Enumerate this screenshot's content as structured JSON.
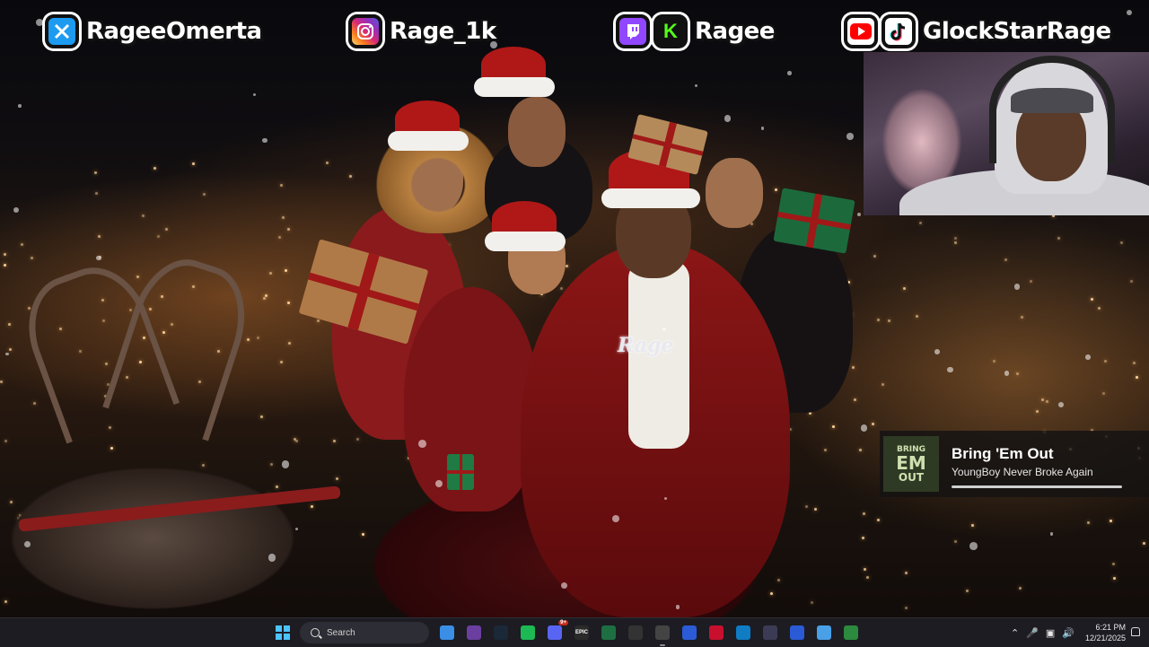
{
  "socials": [
    {
      "platform": "x-twitter",
      "icon": "x-twitter-icon",
      "handle": "RageeOmerta",
      "color": "#1d9bf0"
    },
    {
      "platform": "instagram",
      "icon": "instagram-icon",
      "handle": "Rage_1k",
      "color": "#e1306c"
    },
    {
      "platform": "twitch-kick",
      "icons": [
        "twitch-icon",
        "kick-icon"
      ],
      "handle": "Ragee",
      "colors": [
        "#9146ff",
        "#53fc18"
      ]
    },
    {
      "platform": "youtube-tiktok",
      "icons": [
        "youtube-icon",
        "tiktok-icon"
      ],
      "handle": "GlockStarRage",
      "colors": [
        "#ff0000",
        "#111111"
      ]
    }
  ],
  "scene": {
    "chain_pendant": "Rage"
  },
  "now_playing": {
    "cover_lines": [
      "BRING",
      "EM",
      "OUT"
    ],
    "title": "Bring 'Em Out",
    "artist": "YoungBoy Never Broke Again",
    "progress": 1.0
  },
  "taskbar": {
    "search_placeholder": "Search",
    "apps": [
      {
        "name": "photos",
        "icon": "photos-icon",
        "color": "#3a8ee6"
      },
      {
        "name": "obs",
        "icon": "obs-icon",
        "color": "#6a3fa0"
      },
      {
        "name": "steam",
        "icon": "steam-icon",
        "color": "#1b2838"
      },
      {
        "name": "spotify",
        "icon": "spotify-icon",
        "color": "#1db954"
      },
      {
        "name": "discord",
        "icon": "discord-icon",
        "color": "#5865f2",
        "badge": "9+"
      },
      {
        "name": "epic-games",
        "icon": "epic-games-icon",
        "color": "#2a2a2a",
        "label": "EPIC"
      },
      {
        "name": "excel",
        "icon": "excel-icon",
        "color": "#1d6f42"
      },
      {
        "name": "github",
        "icon": "g-app-icon",
        "color": "#333333"
      },
      {
        "name": "chrome-record",
        "icon": "recording-app-icon",
        "color": "#444444",
        "active": true
      },
      {
        "name": "arc",
        "icon": "arc-icon",
        "color": "#2b5bd7"
      },
      {
        "name": "k-app",
        "icon": "k-app-icon",
        "color": "#c8102e"
      },
      {
        "name": "edge",
        "icon": "edge-icon",
        "color": "#0f7cc4"
      },
      {
        "name": "media-player",
        "icon": "media-player-icon",
        "color": "#3b3b55"
      },
      {
        "name": "playstation",
        "icon": "playstation-icon",
        "color": "#2a5ad6"
      },
      {
        "name": "notepad",
        "icon": "notepad-icon",
        "color": "#4aa0e6"
      },
      {
        "name": "terminal",
        "icon": "play-terminal-icon",
        "color": "#2b8a3e"
      }
    ],
    "tray": {
      "time": "6:21 PM",
      "date": "12/21/2025"
    }
  }
}
